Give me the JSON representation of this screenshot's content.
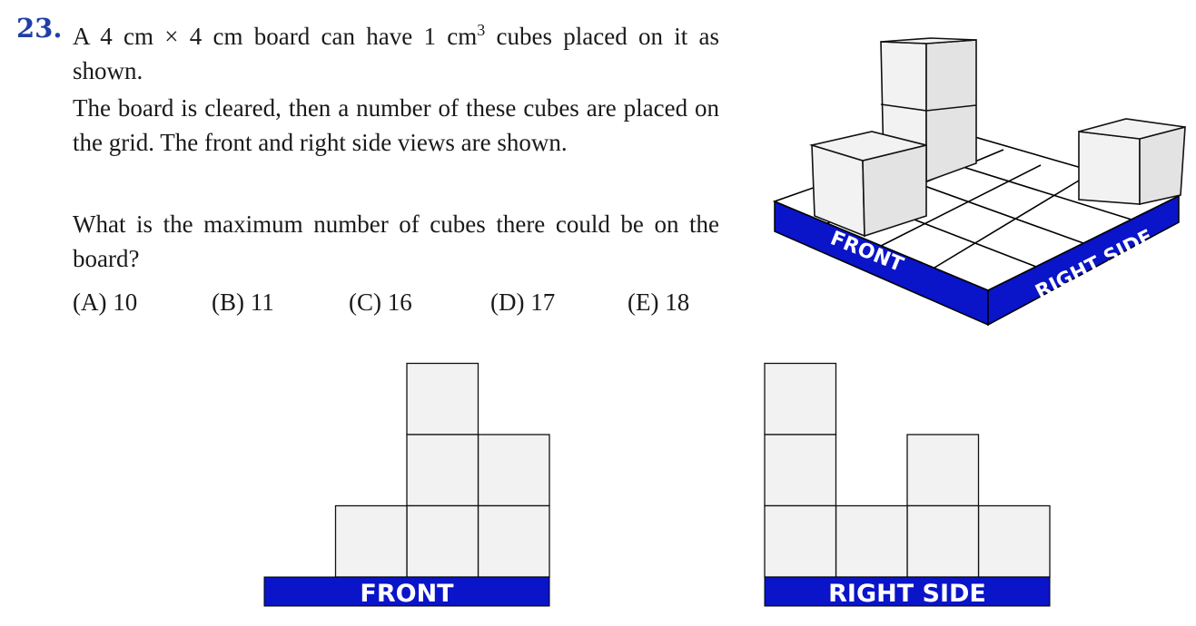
{
  "question": {
    "number": "23.",
    "line1_before": "A 4 cm × 4 cm board can have 1 cm",
    "line1_sup": "3",
    "line1_after": " cubes placed on it as shown.",
    "para2": "The board is cleared, then a number of these cubes are placed on the grid. The front and right side views are shown.",
    "para3": "What is the maximum number of cubes there could be on the board?",
    "answers": [
      "(A) 10",
      "(B) 11",
      "(C) 16",
      "(D) 17",
      "(E) 18"
    ]
  },
  "board": {
    "front_label": "FRONT",
    "right_label": "RIGHT SIDE",
    "accent_color": "#0a14c8"
  },
  "front_view": {
    "label": "FRONT",
    "column_heights": [
      0,
      1,
      3,
      2
    ]
  },
  "right_view": {
    "label": "RIGHT SIDE",
    "column_heights": [
      3,
      1,
      2,
      1
    ]
  }
}
